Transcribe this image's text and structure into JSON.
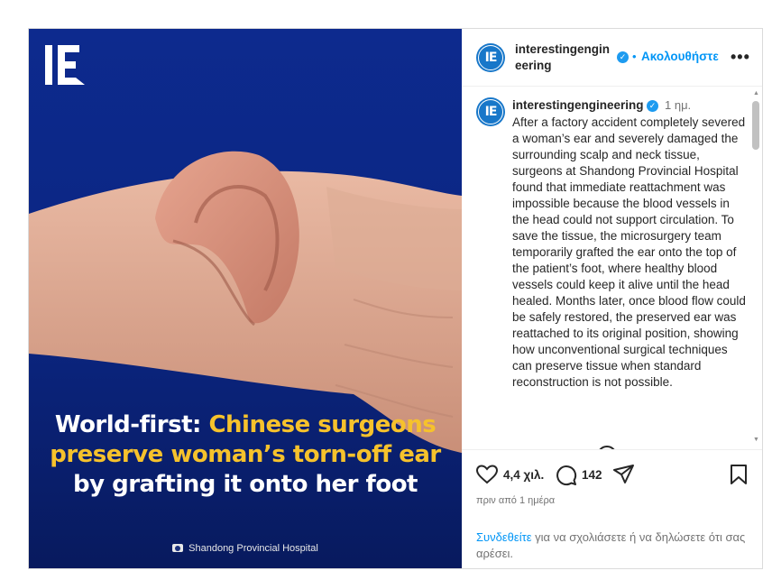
{
  "media": {
    "logo_text": "IE",
    "headline_part1": "World-first: ",
    "headline_part2": "Chinese surgeons preserve woman’s torn-off ear",
    "headline_part3": " by grafting it onto her foot",
    "credit": "Shandong Provincial Hospital",
    "colors": {
      "background": "#0b2580",
      "highlight": "#f6c22c"
    }
  },
  "header": {
    "username": "interestingengineering",
    "follow_label": "Ακολουθήστε",
    "separator": "•",
    "more_icon": "more-icon"
  },
  "caption": {
    "username": "interestingengineering",
    "time": "1 ημ.",
    "text": "After a factory accident completely severed a woman’s ear and severely damaged the surrounding scalp and neck tissue, surgeons at Shandong Provincial Hospital found that immediate reattachment was impossible because the blood vessels in the head could not support circulation. To save the tissue, the microsurgery team temporarily grafted the ear onto the top of the patient’s foot, where healthy blood vessels could keep it alive until the head healed. Months later, once blood flow could be safely restored, the preserved ear was reattached to its original position, showing how unconventional surgical techniques can preserve tissue when standard reconstruction is not possible."
  },
  "actions": {
    "likes": "4,4 χιλ.",
    "comments": "142",
    "date": "πριν από 1 ημέρα",
    "login_link": "Συνδεθείτε",
    "login_text": " για να σχολιάσετε ή να δηλώσετε ότι σας αρέσει."
  },
  "colors": {
    "accent": "#0095f6",
    "avatar": "#1877c9",
    "verified": "#1d9bf0"
  }
}
